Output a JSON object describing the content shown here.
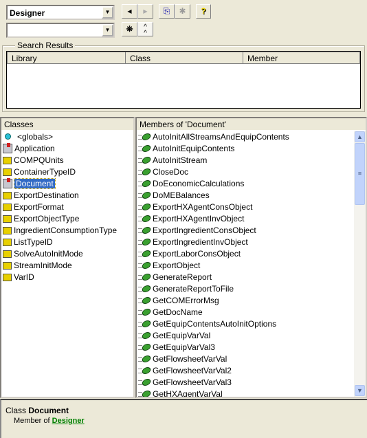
{
  "toolbar": {
    "library_combo": {
      "value": "Designer"
    },
    "search_combo": {
      "value": "",
      "placeholder": ""
    },
    "back_icon": "triangle-left",
    "forward_icon": "triangle-right",
    "copy_icon": "copy",
    "view_definition_icon": "view-definition",
    "help_icon": "?",
    "search_icon": "binoculars",
    "toggle_icon": "chevron-up-double"
  },
  "search_results": {
    "title": "Search Results",
    "columns": [
      "Library",
      "Class",
      "Member"
    ]
  },
  "classes": {
    "title": "Classes",
    "items": [
      {
        "label": "<globals>",
        "icon": "globals"
      },
      {
        "label": "Application",
        "icon": "class-module"
      },
      {
        "label": "COMPQUnits",
        "icon": "enum"
      },
      {
        "label": "ContainerTypeID",
        "icon": "enum"
      },
      {
        "label": "Document",
        "icon": "class-module",
        "selected": true
      },
      {
        "label": "ExportDestination",
        "icon": "enum"
      },
      {
        "label": "ExportFormat",
        "icon": "enum"
      },
      {
        "label": "ExportObjectType",
        "icon": "enum"
      },
      {
        "label": "IngredientConsumptionType",
        "icon": "enum"
      },
      {
        "label": "ListTypeID",
        "icon": "enum"
      },
      {
        "label": "SolveAutoInitMode",
        "icon": "enum"
      },
      {
        "label": "StreamInitMode",
        "icon": "enum"
      },
      {
        "label": "VarID",
        "icon": "enum"
      }
    ]
  },
  "members": {
    "title": "Members of 'Document'",
    "items": [
      "AutoInitAllStreamsAndEquipContents",
      "AutoInitEquipContents",
      "AutoInitStream",
      "CloseDoc",
      "DoEconomicCalculations",
      "DoMEBalances",
      "ExportHXAgentConsObject",
      "ExportHXAgentInvObject",
      "ExportIngredientConsObject",
      "ExportIngredientInvObject",
      "ExportLaborConsObject",
      "ExportObject",
      "GenerateReport",
      "GenerateReportToFile",
      "GetCOMErrorMsg",
      "GetDocName",
      "GetEquipContentsAutoInitOptions",
      "GetEquipVarVal",
      "GetEquipVarVal3",
      "GetFlowsheetVarVal",
      "GetFlowsheetVarVal2",
      "GetFlowsheetVarVal3",
      "GetHXAgentVarVal"
    ]
  },
  "details": {
    "kind": "Class",
    "name": "Document",
    "member_of_label": "Member of",
    "member_of_link": "Designer",
    "link_color": "#008000"
  }
}
